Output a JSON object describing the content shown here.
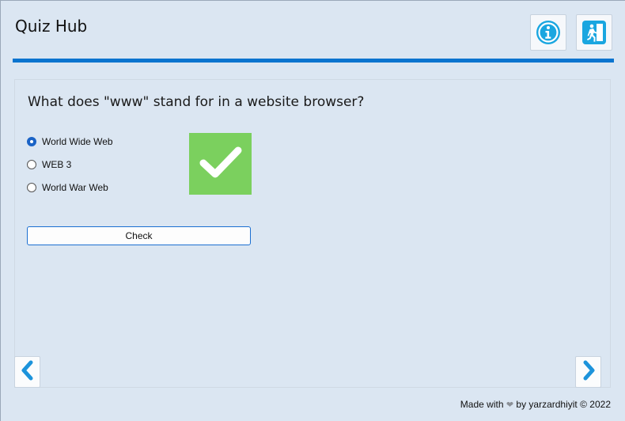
{
  "app": {
    "title": "Quiz Hub"
  },
  "header": {
    "info_icon": "info-icon",
    "exit_icon": "exit-door-icon",
    "accent": "#0a74cf"
  },
  "quiz": {
    "question": "What does \"www\" stand for in a website browser?",
    "options": [
      {
        "label": "World Wide Web",
        "selected": true
      },
      {
        "label": "WEB 3",
        "selected": false
      },
      {
        "label": "World War Web",
        "selected": false
      }
    ],
    "feedback": {
      "icon": "checkmark-icon",
      "status": "correct",
      "color": "#7bd05e"
    },
    "check_label": "Check"
  },
  "nav": {
    "prev_icon": "chevron-left-icon",
    "next_icon": "chevron-right-icon"
  },
  "footer": {
    "made_with": "Made with",
    "heart_icon": "heart-icon",
    "by_text": "by yarzardhiyit",
    "copyright": "© 2022"
  }
}
